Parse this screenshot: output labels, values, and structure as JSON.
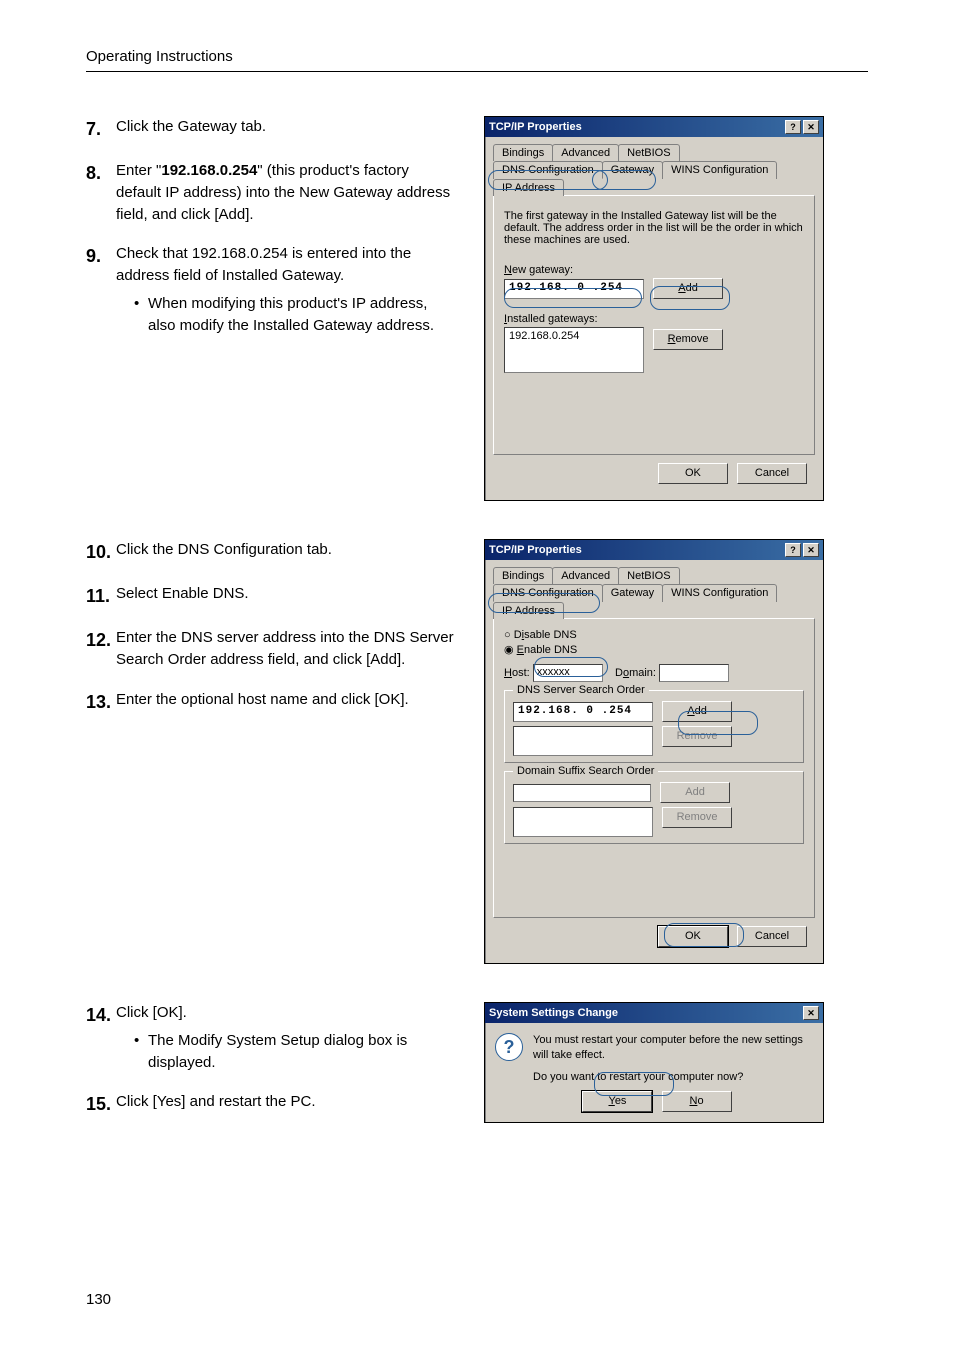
{
  "running_head": "Operating Instructions",
  "page_number": "130",
  "steps_a": [
    {
      "n": "7.",
      "text": "Click the Gateway tab."
    },
    {
      "n": "8.",
      "prefix": "Enter \"",
      "bold": "192.168.0.254",
      "suffix": "\" (this product's factory default IP address) into the New Gateway address field, and click [Add]."
    },
    {
      "n": "9.",
      "text": "Check that 192.168.0.254 is entered into the address field of Installed Gateway.",
      "bullet": "When modifying this product's IP address, also modify the Installed Gateway address."
    }
  ],
  "steps_b": [
    {
      "n": "10.",
      "text": "Click the DNS Configuration tab."
    },
    {
      "n": "11.",
      "text": "Select Enable DNS."
    },
    {
      "n": "12.",
      "text": "Enter the DNS server address into the DNS Server Search Order address field, and click [Add]."
    },
    {
      "n": "13.",
      "text": "Enter the optional host name and click [OK]."
    }
  ],
  "steps_c": [
    {
      "n": "14.",
      "text": "Click [OK].",
      "bullet": "The Modify System Setup dialog box is displayed."
    },
    {
      "n": "15.",
      "text": "Click [Yes] and restart the PC."
    }
  ],
  "dlg1": {
    "title": "TCP/IP Properties",
    "tabs_top": [
      "Bindings",
      "Advanced",
      "NetBIOS"
    ],
    "tabs_bottom": [
      "DNS Configuration",
      "Gateway",
      "WINS Configuration",
      "IP Address"
    ],
    "active_tab": "Gateway",
    "help": "The first gateway in the Installed Gateway list will be the default. The address order in the list will be the order in which these machines are used.",
    "new_gateway_label": "New gateway:",
    "new_gateway_value": "192.168. 0 .254",
    "add_label": "Add",
    "installed_label": "Installed gateways:",
    "installed_value": "192.168.0.254",
    "remove_label": "Remove",
    "ok": "OK",
    "cancel": "Cancel"
  },
  "dlg2": {
    "title": "TCP/IP Properties",
    "tabs_top": [
      "Bindings",
      "Advanced",
      "NetBIOS"
    ],
    "tabs_bottom": [
      "DNS Configuration",
      "Gateway",
      "WINS Configuration",
      "IP Address"
    ],
    "active_tab": "DNS Configuration",
    "disable_label": "Disable DNS",
    "enable_label": "Enable DNS",
    "host_label": "Host:",
    "host_value": "xxxxxx",
    "domain_label": "Domain:",
    "dns_order_label": "DNS Server Search Order",
    "dns_value": "192.168. 0 .254",
    "add_label": "Add",
    "remove_label": "Remove",
    "suffix_label": "Domain Suffix Search Order",
    "add2_label": "Add",
    "remove2_label": "Remove",
    "ok": "OK",
    "cancel": "Cancel"
  },
  "dlg3": {
    "title": "System Settings Change",
    "line1": "You must restart your computer before the new settings will take effect.",
    "line2": "Do you want to restart your computer now?",
    "yes": "Yes",
    "no": "No"
  }
}
